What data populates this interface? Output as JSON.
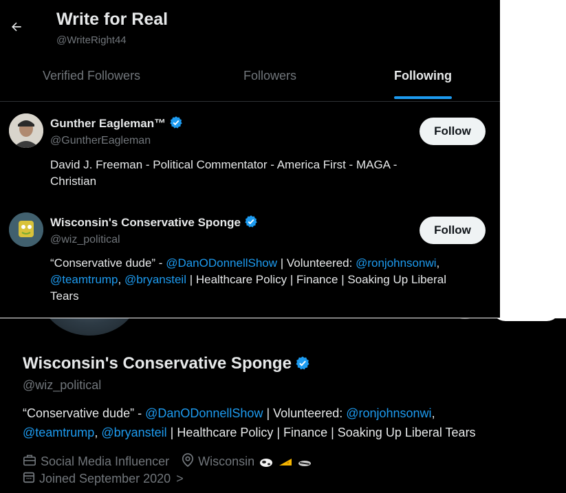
{
  "header": {
    "title": "Write for Real",
    "handle": "@WriteRight44"
  },
  "tabs": [
    {
      "label": "Verified Followers"
    },
    {
      "label": "Followers"
    },
    {
      "label": "Following"
    }
  ],
  "users": [
    {
      "name": "Gunther Eagleman™",
      "handle": "@GuntherEagleman",
      "bio_line1": "David J. Freeman - Political Commentator - America First - MAGA -",
      "bio_line2": "Christian",
      "follow_label": "Follow"
    },
    {
      "name": "Wisconsin's Conservative Sponge",
      "handle": "@wiz_political",
      "bio": {
        "quote": "“Conservative dude” - ",
        "m1": "@DanODonnellShow",
        "t1": " | Volunteered: ",
        "m2": "@ronjohnsonwi",
        "t2": ",",
        "m3": "@teamtrump",
        "t3": ", ",
        "m4": "@bryansteil",
        "t4": " | Healthcare Policy | Finance | Soaking Up Liberal",
        "t5": "Tears"
      },
      "follow_label": "Follow"
    }
  ],
  "profile": {
    "name": "Wisconsin's Conservative Sponge",
    "handle": "@wiz_political",
    "bio": {
      "quote": "“Conservative dude” - ",
      "m1": "@DanODonnellShow",
      "t1": " | Volunteered: ",
      "m2": "@ronjohnsonwi",
      "t2": ",",
      "m3": "@teamtrump",
      "t3": ", ",
      "m4": "@bryansteil",
      "t4": " | Healthcare Policy | Finance | Soaking Up Liberal Tears"
    },
    "category": "Social Media Influencer",
    "location": "Wisconsin",
    "joined": "Joined September 2020",
    "joined_chevron": ">"
  },
  "colors": {
    "accent": "#1d9bf0",
    "background": "#000000",
    "muted": "#71767b",
    "text": "#e7e9ea"
  }
}
